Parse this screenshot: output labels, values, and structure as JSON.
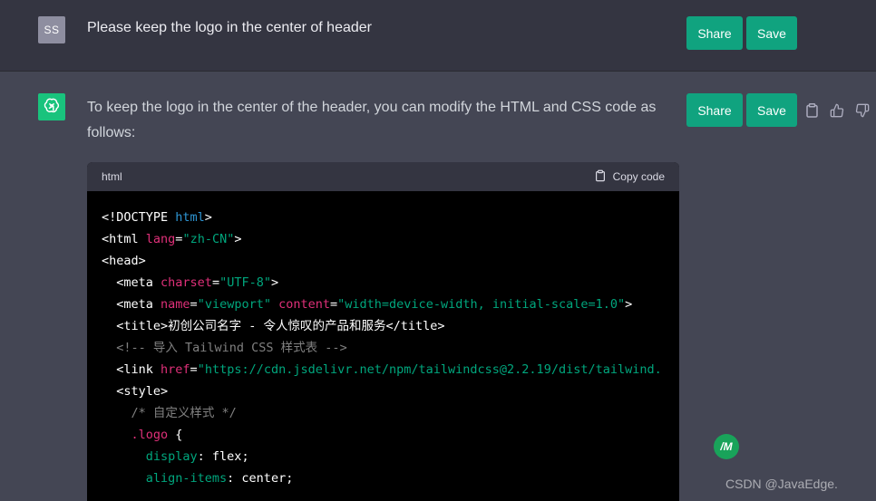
{
  "user_message": {
    "avatar_initials": "SS",
    "text": "Please keep the logo in the center of header"
  },
  "assistant_message": {
    "text": "To keep the logo in the center of the header, you can modify the HTML and CSS code as follows:",
    "icons": [
      "clipboard-icon",
      "thumbs-up-icon",
      "thumbs-down-icon"
    ]
  },
  "buttons": {
    "share_label": "Share",
    "save_label": "Save"
  },
  "code_block": {
    "language": "html",
    "copy_label": "Copy code",
    "lines": [
      [
        {
          "t": "<!DOCTYPE ",
          "c": "c-tag"
        },
        {
          "t": "html",
          "c": "c-kw"
        },
        {
          "t": ">",
          "c": "c-tag"
        }
      ],
      [
        {
          "t": "<html ",
          "c": "c-tag"
        },
        {
          "t": "lang",
          "c": "c-attr"
        },
        {
          "t": "=",
          "c": "c-tag"
        },
        {
          "t": "\"zh-CN\"",
          "c": "c-val"
        },
        {
          "t": ">",
          "c": "c-tag"
        }
      ],
      [
        {
          "t": "<head>",
          "c": "c-tag"
        }
      ],
      [
        {
          "t": "  <meta ",
          "c": "c-tag"
        },
        {
          "t": "charset",
          "c": "c-attr"
        },
        {
          "t": "=",
          "c": "c-tag"
        },
        {
          "t": "\"UTF-8\"",
          "c": "c-val"
        },
        {
          "t": ">",
          "c": "c-tag"
        }
      ],
      [
        {
          "t": "  <meta ",
          "c": "c-tag"
        },
        {
          "t": "name",
          "c": "c-attr"
        },
        {
          "t": "=",
          "c": "c-tag"
        },
        {
          "t": "\"viewport\"",
          "c": "c-val"
        },
        {
          "t": " ",
          "c": "c-tag"
        },
        {
          "t": "content",
          "c": "c-attr"
        },
        {
          "t": "=",
          "c": "c-tag"
        },
        {
          "t": "\"width=device-width, initial-scale=1.0\"",
          "c": "c-val"
        },
        {
          "t": ">",
          "c": "c-tag"
        }
      ],
      [
        {
          "t": "  <title>初创公司名字 - 令人惊叹的产品和服务</title>",
          "c": "c-tag"
        }
      ],
      [
        {
          "t": "  <!-- 导入 Tailwind CSS 样式表 -->",
          "c": "c-comment"
        }
      ],
      [
        {
          "t": "  <link ",
          "c": "c-tag"
        },
        {
          "t": "href",
          "c": "c-attr"
        },
        {
          "t": "=",
          "c": "c-tag"
        },
        {
          "t": "\"https://cdn.jsdelivr.net/npm/tailwindcss@2.2.19/dist/tailwind.",
          "c": "c-val"
        }
      ],
      [
        {
          "t": "  <style>",
          "c": "c-tag"
        }
      ],
      [
        {
          "t": "    /* 自定义样式 */",
          "c": "c-comment"
        }
      ],
      [
        {
          "t": "    .logo",
          "c": "c-attr"
        },
        {
          "t": " {",
          "c": "c-tag"
        }
      ],
      [
        {
          "t": "      display",
          "c": "c-prop"
        },
        {
          "t": ": flex;",
          "c": "c-tag"
        }
      ],
      [
        {
          "t": "      align-items",
          "c": "c-prop"
        },
        {
          "t": ": center;",
          "c": "c-tag"
        }
      ]
    ]
  },
  "fab": {
    "label": "/M"
  },
  "watermark": "CSDN @JavaEdge."
}
